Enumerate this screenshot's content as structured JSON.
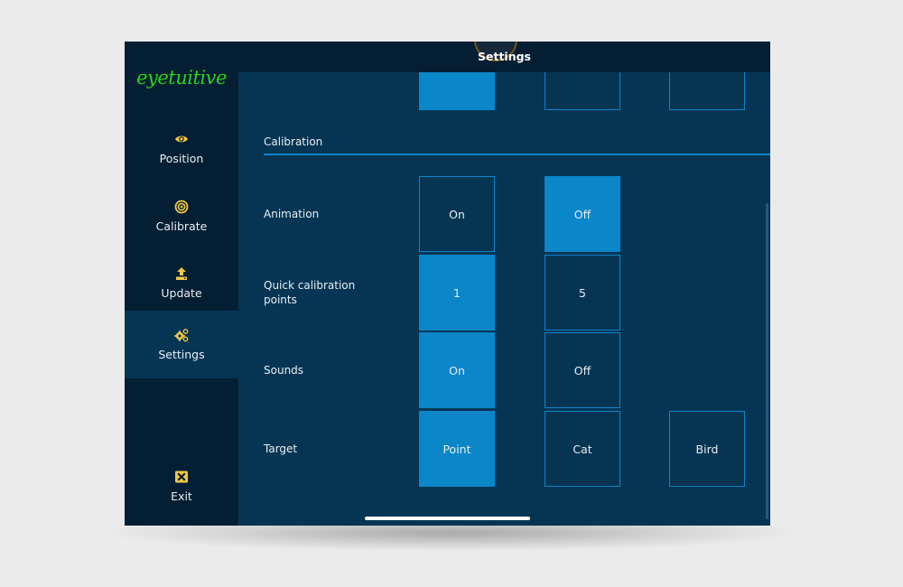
{
  "app": {
    "logo_text": "eyetuitive",
    "title": "Settings"
  },
  "colors": {
    "accent": "#0a86c9",
    "sidebar_bg": "#041f33",
    "content_bg": "#063554",
    "icon": "#f2c744",
    "logo": "#2ed11c"
  },
  "sidebar": {
    "items": [
      {
        "label": "Position",
        "icon": "eye-icon"
      },
      {
        "label": "Calibrate",
        "icon": "target-icon"
      },
      {
        "label": "Update",
        "icon": "upload-icon"
      },
      {
        "label": "Settings",
        "icon": "gears-icon",
        "active": true
      },
      {
        "label": "Exit",
        "icon": "close-box-icon"
      }
    ]
  },
  "top_partial_row": {
    "options": [
      {
        "label": "",
        "selected": true
      },
      {
        "label": "",
        "selected": false
      },
      {
        "label": "",
        "selected": false
      }
    ]
  },
  "section": {
    "title": "Calibration"
  },
  "settings": [
    {
      "label": "Animation",
      "options": [
        {
          "label": "On",
          "selected": false
        },
        {
          "label": "Off",
          "selected": true
        }
      ]
    },
    {
      "label": "Quick calibration points",
      "label_line1": "Quick calibration",
      "label_line2": "points",
      "options": [
        {
          "label": "1",
          "selected": true
        },
        {
          "label": "5",
          "selected": false
        }
      ]
    },
    {
      "label": "Sounds",
      "options": [
        {
          "label": "On",
          "selected": true
        },
        {
          "label": "Off",
          "selected": false
        }
      ]
    },
    {
      "label": "Target",
      "options": [
        {
          "label": "Point",
          "selected": true
        },
        {
          "label": "Cat",
          "selected": false
        },
        {
          "label": "Bird",
          "selected": false
        }
      ]
    }
  ]
}
